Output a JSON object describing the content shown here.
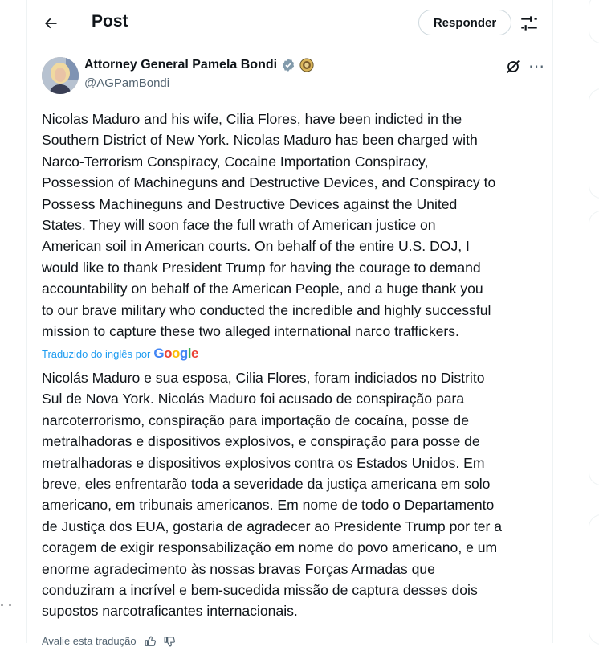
{
  "header": {
    "title": "Post",
    "reply_label": "Responder"
  },
  "author": {
    "name": "Attorney General Pamela Bondi",
    "handle": "@AGPamBondi"
  },
  "post": {
    "text": "Nicolas Maduro and his wife, Cilia Flores, have been indicted in the\nSouthern District of New York.  Nicolas Maduro has been charged with\nNarco-Terrorism Conspiracy, Cocaine Importation Conspiracy,\nPossession of Machineguns and Destructive Devices, and Conspiracy to\nPossess Machineguns and Destructive Devices against the United\nStates.  They will soon face the full wrath of American justice on\nAmerican soil in American courts. On behalf of the entire U.S. DOJ, I\nwould like to thank President Trump for having the courage to demand\naccountability on behalf of the American People, and a huge thank you\nto our brave military who conducted the incredible and highly successful\nmission to capture these two alleged international narco traffickers.",
    "translated_by": "Traduzido do inglês por",
    "google_label": "Google",
    "translation": "Nicolás Maduro e sua esposa, Cilia Flores, foram indiciados no Distrito\nSul de Nova York. Nicolás Maduro foi acusado de conspiração para\nnarcoterrorismo, conspiração para importação de cocaína, posse de\nmetralhadoras e dispositivos explosivos, e conspiração para posse de\nmetralhadoras e dispositivos explosivos contra os Estados Unidos. Em\nbreve, eles enfrentarão toda a severidade da justiça americana em solo\namericano, em tribunais americanos. Em nome de todo o Departamento\nde Justiça dos EUA, gostaria de agradecer ao Presidente Trump por ter a\ncoragem de exigir responsabilização em nome do povo americano, e um\nenorme agradecimento às nossas bravas Forças Armadas que\nconduziram a incrível e bem-sucedida missão de captura desses dois\nsupostos narcotraficantes internacionais.",
    "rate_translation": "Avalie esta tradução"
  },
  "left_rail": {
    "more_dots": ". ."
  },
  "icons": [
    "back-arrow-icon",
    "sliders-icon",
    "verified-badge-icon",
    "seal-icon",
    "grok-icon",
    "more-icon",
    "thumbs-up-icon",
    "thumbs-down-icon"
  ],
  "colors": {
    "accent": "#1d9bf0",
    "secondary_text": "#536471",
    "border": "#cfd9de"
  }
}
